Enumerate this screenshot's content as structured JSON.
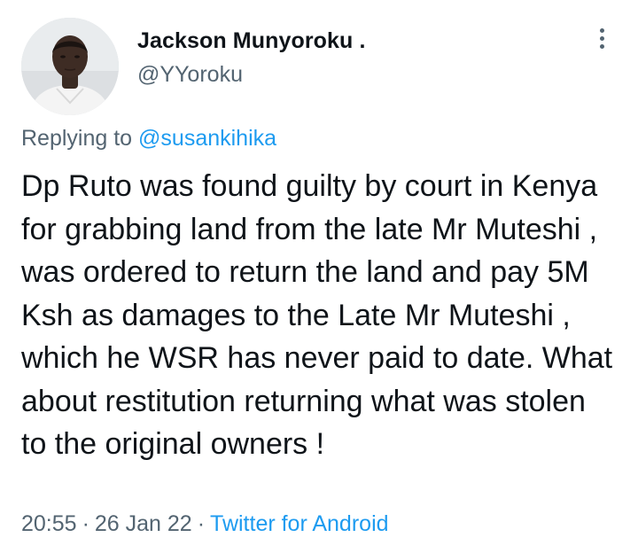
{
  "author": {
    "name": "Jackson Munyoroku .",
    "handle": "@YYoroku"
  },
  "reply": {
    "prefix": "Replying to",
    "mention": "@susankihika"
  },
  "tweet": {
    "text": "Dp Ruto was found guilty by court in Kenya for grabbing land from the late Mr Muteshi , was ordered to return the land and pay 5M Ksh as damages to the Late Mr Muteshi , which he WSR has never paid to date. What about restitution returning what was stolen to the original owners !"
  },
  "meta": {
    "time": "20:55",
    "separator_1": "·",
    "date": "26 Jan 22",
    "separator_2": "·",
    "source": "Twitter for Android"
  },
  "icons": {
    "more": "more-vertical-icon",
    "avatar": "profile-avatar"
  },
  "colors": {
    "text_primary": "#0f1419",
    "text_secondary": "#536471",
    "link": "#1d9bf0",
    "background": "#ffffff"
  }
}
